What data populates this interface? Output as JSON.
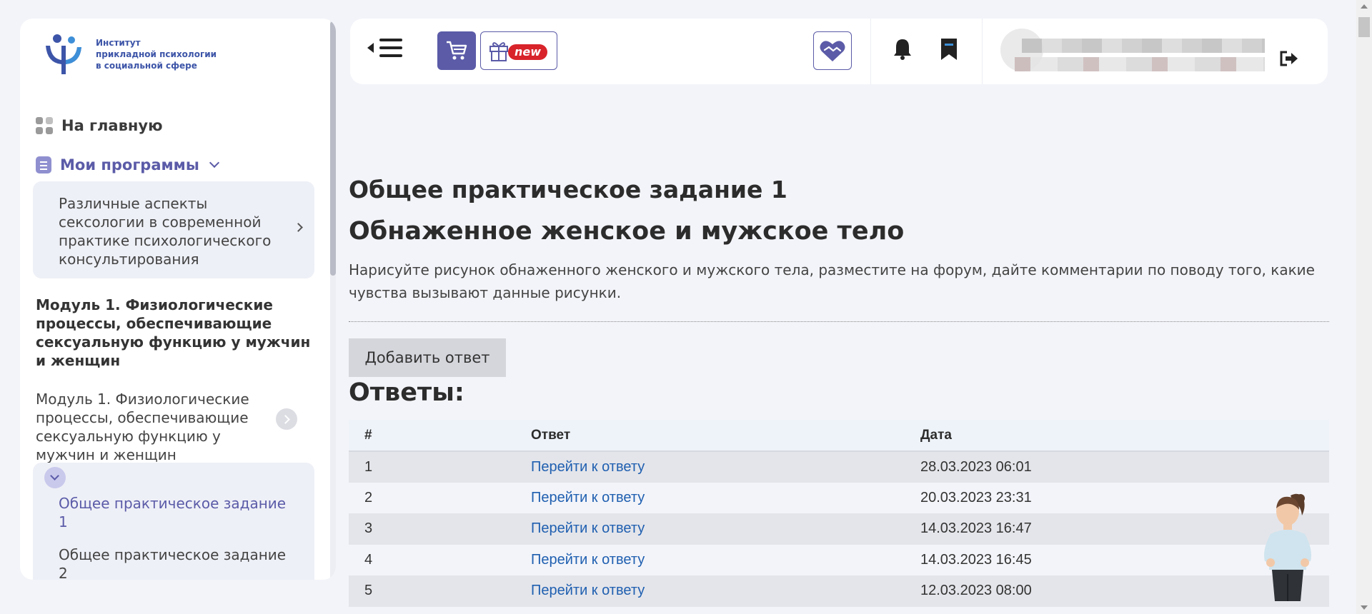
{
  "logo": {
    "line1": "Институт",
    "line2": "прикладной психологии",
    "line3": "в социальной сфере"
  },
  "sidebar": {
    "home_label": "На главную",
    "programs_label": "Мои программы",
    "program_card": "Различные аспекты сексологии в современной практике психологического консультирования",
    "module_heading": "Модуль 1. Физиологические процессы, обеспечивающие сексуальную функцию у мужчин и женщин",
    "module_link": "Модуль 1. Физиологические процессы, обеспечивающие сексуальную функцию у мужчин и женщин",
    "task_active": "Общее практическое задание 1",
    "task_next": "Общее практическое задание 2"
  },
  "header": {
    "new_badge": "new",
    "icons": [
      "back-triangle-icon",
      "menu-icon",
      "cart-icon",
      "gift-icon",
      "handshake-icon",
      "bell-icon",
      "bookmark-icon",
      "logout-icon"
    ],
    "accent": "#5b5ba8",
    "badge_color": "#d8232a"
  },
  "main": {
    "title": "Общее практическое задание 1",
    "subtitle": "Обнаженное женское и мужское тело",
    "description": "Нарисуйте рисунок обнаженного женского и мужского тела, разместите на форум, дайте комментарии по поводу того, какие чувства вызывают данные рисунки.",
    "add_button": "Добавить ответ",
    "answers_heading": "Ответы:"
  },
  "table": {
    "headers": [
      "#",
      "Ответ",
      "Дата"
    ],
    "rows": [
      {
        "num": "1",
        "link": "Перейти к ответу",
        "date": "28.03.2023 06:01"
      },
      {
        "num": "2",
        "link": "Перейти к ответу",
        "date": "20.03.2023 23:31"
      },
      {
        "num": "3",
        "link": "Перейти к ответу",
        "date": "14.03.2023 16:47"
      },
      {
        "num": "4",
        "link": "Перейти к ответу",
        "date": "14.03.2023 16:45"
      },
      {
        "num": "5",
        "link": "Перейти к ответу",
        "date": "12.03.2023 08:00"
      }
    ]
  }
}
